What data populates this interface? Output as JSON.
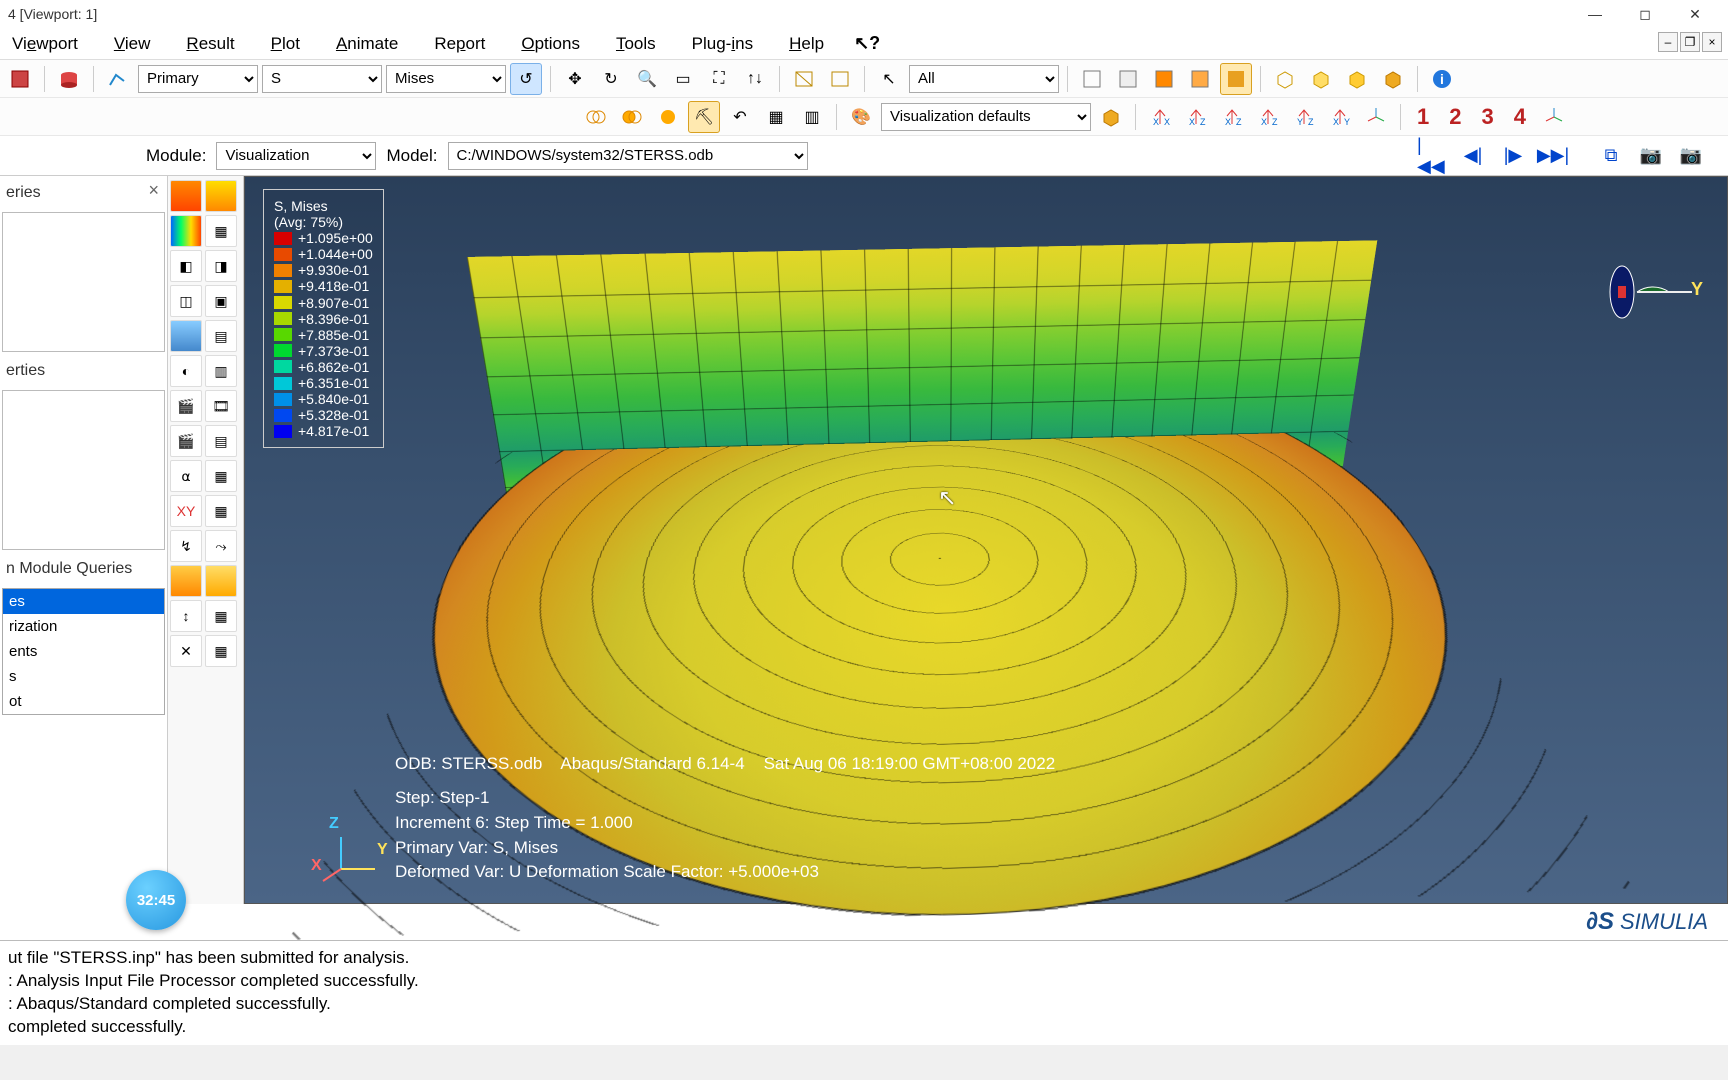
{
  "window": {
    "title": "4 [Viewport: 1]"
  },
  "menu": {
    "items": [
      "Viewport",
      "View",
      "Result",
      "Plot",
      "Animate",
      "Report",
      "Options",
      "Tools",
      "Plug-ins",
      "Help"
    ]
  },
  "toolbar1": {
    "field_select_1": "Primary",
    "field_select_2": "S",
    "field_select_3": "Mises",
    "selection_select": "All"
  },
  "toolbar2": {
    "vis_defaults": "Visualization defaults",
    "axis_labels": [
      "X X",
      "X Z",
      "X Z",
      "X Z",
      "Y Z",
      "X Y"
    ],
    "numbers": [
      "1",
      "2",
      "3",
      "4"
    ]
  },
  "context": {
    "module_label": "Module:",
    "module_value": "Visualization",
    "model_label": "Model:",
    "model_value": "C:/WINDOWS/system32/STERSS.odb"
  },
  "query_panel": {
    "header1": "eries",
    "header2": "erties",
    "list_title": "n Module Queries",
    "items": [
      "es",
      "rization",
      "ents",
      "s",
      "ot"
    ]
  },
  "legend": {
    "title1": "S, Mises",
    "title2": "(Avg: 75%)",
    "rows": [
      {
        "color": "#d80000",
        "val": "+1.095e+00"
      },
      {
        "color": "#e84a00",
        "val": "+1.044e+00"
      },
      {
        "color": "#f08000",
        "val": "+9.930e-01"
      },
      {
        "color": "#e4b000",
        "val": "+9.418e-01"
      },
      {
        "color": "#d8d800",
        "val": "+8.907e-01"
      },
      {
        "color": "#a8d800",
        "val": "+8.396e-01"
      },
      {
        "color": "#58d800",
        "val": "+7.885e-01"
      },
      {
        "color": "#00d830",
        "val": "+7.373e-01"
      },
      {
        "color": "#00d8a0",
        "val": "+6.862e-01"
      },
      {
        "color": "#00c8d8",
        "val": "+6.351e-01"
      },
      {
        "color": "#0090e8",
        "val": "+5.840e-01"
      },
      {
        "color": "#0048f0",
        "val": "+5.328e-01"
      },
      {
        "color": "#0000f0",
        "val": "+4.817e-01"
      }
    ]
  },
  "odb_info": {
    "line1a": "ODB: STERSS.odb",
    "line1b": "Abaqus/Standard 6.14-4",
    "line1c": "Sat Aug 06 18:19:00 GMT+08:00 2022",
    "line2": "Step: Step-1",
    "line3": "Increment      6: Step Time =    1.000",
    "line4": "Primary Var: S, Mises",
    "line5": "Deformed Var: U   Deformation Scale Factor: +5.000e+03"
  },
  "triad": {
    "z": "Z",
    "y": "Y",
    "x": "X"
  },
  "orient_axis": "Y",
  "time_badge": "32:45",
  "simulia_brand": "SIMULIA",
  "console": {
    "l1": "ut file \"STERSS.inp\" has been submitted for analysis.",
    "l2": ": Analysis Input File Processor completed successfully.",
    "l3": ": Abaqus/Standard completed successfully.",
    "l4": " completed successfully."
  }
}
